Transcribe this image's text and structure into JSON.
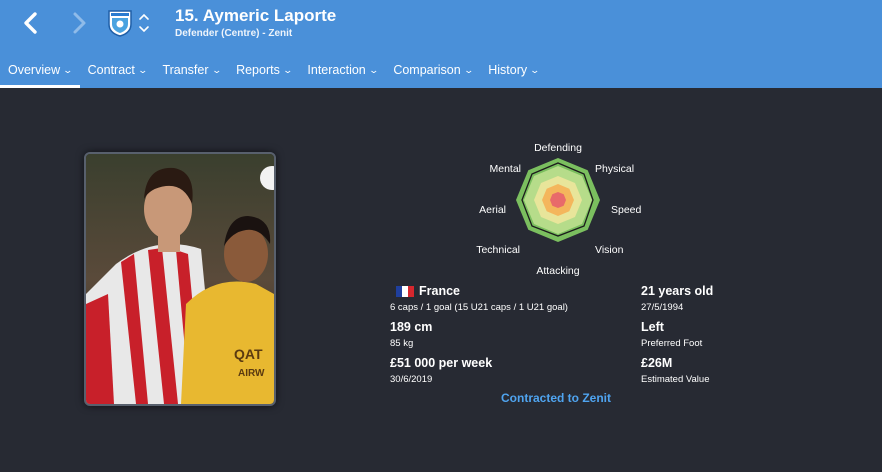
{
  "header": {
    "title": "15. Aymeric Laporte",
    "subtitle": "Defender (Centre) - Zenit",
    "tabs": [
      {
        "label": "Overview"
      },
      {
        "label": "Contract"
      },
      {
        "label": "Transfer"
      },
      {
        "label": "Reports"
      },
      {
        "label": "Interaction"
      },
      {
        "label": "Comparison"
      },
      {
        "label": "History"
      }
    ],
    "colors": {
      "bar": "#4a90d9",
      "background": "#272a33"
    }
  },
  "icons": {
    "back": "chevron-left-icon",
    "forward": "chevron-right-icon",
    "club": "zenit-badge-icon",
    "cycle": "up-down-chevron-icon"
  },
  "radar": {
    "labels": {
      "top": "Defending",
      "top_right": "Physical",
      "right": "Speed",
      "bottom_right": "Vision",
      "bottom": "Attacking",
      "bottom_left": "Technical",
      "left": "Aerial",
      "top_left": "Mental"
    },
    "colors": [
      "#7bbf5f",
      "#b6dc8a",
      "#e8e59a",
      "#f4b65c",
      "#e86a6a"
    ]
  },
  "profile": {
    "nationality": "France",
    "caps": "6 caps / 1 goal (15 U21 caps / 1 U21 goal)",
    "height": "189 cm",
    "weight": "85 kg",
    "wage": "£51 000 per week",
    "contract_end": "30/6/2019",
    "age": "21 years old",
    "dob": "27/5/1994",
    "foot": "Left",
    "foot_label": "Preferred Foot",
    "value": "£26M",
    "value_label": "Estimated Value",
    "contract_link": "Contracted to Zenit"
  }
}
